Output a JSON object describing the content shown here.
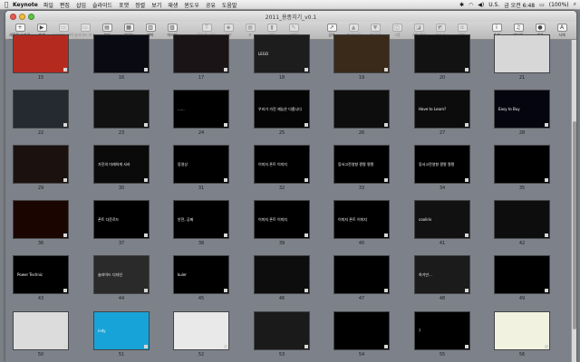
{
  "menubar": {
    "app_name": "Keynote",
    "menus": [
      "파일",
      "편집",
      "삽입",
      "슬라이드",
      "포맷",
      "정렬",
      "보기",
      "재생",
      "윈도우",
      "공유",
      "도움말"
    ],
    "clock": "금 오전 6:48",
    "battery": "(100%)",
    "input_source": "U.S."
  },
  "window": {
    "title": "2011_용종치기_v0.1"
  },
  "toolbar": {
    "left": [
      {
        "label": "새로운 슬라이드",
        "icon": "+",
        "enabled": true
      },
      {
        "label": "재생",
        "icon": "▶",
        "enabled": true
      },
      {
        "label": "슬라이드 레이아웃",
        "icon": "▭",
        "enabled": false
      },
      {
        "label": "슬라이드 마스터",
        "icon": "▭",
        "enabled": false
      },
      {
        "label": "보기",
        "icon": "▤",
        "enabled": true
      },
      {
        "label": "가이드",
        "icon": "▦",
        "enabled": true
      },
      {
        "label": "테마",
        "icon": "▥",
        "enabled": true
      },
      {
        "label": "마스터",
        "icon": "▧",
        "enabled": true
      }
    ],
    "middle": [
      {
        "label": "텍스트 상자",
        "icon": "T",
        "enabled": false
      },
      {
        "label": "도형",
        "icon": "◆",
        "enabled": false
      },
      {
        "label": "표",
        "icon": "▦",
        "enabled": false
      },
      {
        "label": "차트",
        "icon": "▮",
        "enabled": false
      },
      {
        "label": "코멘트",
        "icon": "✎",
        "enabled": false
      }
    ],
    "right_middle": [
      {
        "label": "공유",
        "icon": "↗",
        "enabled": true
      },
      {
        "label": "맨 앞으로",
        "icon": "▲",
        "enabled": false
      },
      {
        "label": "맨 뒤로",
        "icon": "▼",
        "enabled": false
      },
      {
        "label": "그룹",
        "icon": "◫",
        "enabled": false
      },
      {
        "label": "그룹 해제",
        "icon": "◪",
        "enabled": false
      },
      {
        "label": "마스크",
        "icon": "◩",
        "enabled": false
      },
      {
        "label": "알파",
        "icon": "α",
        "enabled": false
      }
    ],
    "right": [
      {
        "label": "속성",
        "icon": "i",
        "enabled": true
      },
      {
        "label": "미디어",
        "icon": "♫",
        "enabled": true
      },
      {
        "label": "색상",
        "icon": "●",
        "enabled": true
      },
      {
        "label": "서체",
        "icon": "A",
        "enabled": true
      }
    ]
  },
  "slides": [
    {
      "n": "15",
      "bg": "#b52a1f",
      "text": ""
    },
    {
      "n": "16",
      "bg": "#0a0a12",
      "text": ""
    },
    {
      "n": "17",
      "bg": "#1a1416",
      "text": ""
    },
    {
      "n": "18",
      "bg": "#1d1d1d",
      "text": "LEGO"
    },
    {
      "n": "19",
      "bg": "#3a2a1a",
      "text": ""
    },
    {
      "n": "20",
      "bg": "#121212",
      "text": ""
    },
    {
      "n": "21",
      "bg": "#d7d7d7",
      "text": ""
    },
    {
      "n": "22",
      "bg": "#242a30",
      "text": ""
    },
    {
      "n": "23",
      "bg": "#111111",
      "text": ""
    },
    {
      "n": "24",
      "bg": "#000000",
      "text": "......"
    },
    {
      "n": "25",
      "bg": "#050505",
      "text": "우리가 가진 재능은 다릅니다"
    },
    {
      "n": "26",
      "bg": "#0d0d0d",
      "text": ""
    },
    {
      "n": "27",
      "bg": "#0c0c0c",
      "text": "Have to Learn?"
    },
    {
      "n": "28",
      "bg": "#050510",
      "text": "Easy to Buy"
    },
    {
      "n": "29",
      "bg": "#1b1210",
      "text": ""
    },
    {
      "n": "30",
      "bg": "#0a0a0a",
      "text": "가진의 미래하게 사라"
    },
    {
      "n": "31",
      "bg": "#000000",
      "text": "동영상"
    },
    {
      "n": "32",
      "bg": "#000000",
      "text": "이미지 폰트 이미지"
    },
    {
      "n": "33",
      "bg": "#000000",
      "text": "동서고전영향 짱짱 짱짱"
    },
    {
      "n": "34",
      "bg": "#000000",
      "text": "동서고전영향 짱짱 짱짱"
    },
    {
      "n": "35",
      "bg": "#000000",
      "text": ""
    },
    {
      "n": "36",
      "bg": "#1a0500",
      "text": ""
    },
    {
      "n": "37",
      "bg": "#000000",
      "text": "폰트 다운로드"
    },
    {
      "n": "38",
      "bg": "#000000",
      "text": "안전, 공짜"
    },
    {
      "n": "39",
      "bg": "#000000",
      "text": "이미지 폰트 이미지"
    },
    {
      "n": "40",
      "bg": "#000000",
      "text": "이미지 폰트 이미지"
    },
    {
      "n": "41",
      "bg": "#111111",
      "text": "cooliris"
    },
    {
      "n": "42",
      "bg": "#0d0d0d",
      "text": ""
    },
    {
      "n": "43",
      "bg": "#000000",
      "text": "Power Technic"
    },
    {
      "n": "44",
      "bg": "#2a2a2a",
      "text": "슬라이드 디자인"
    },
    {
      "n": "45",
      "bg": "#000000",
      "text": "kuler"
    },
    {
      "n": "46",
      "bg": "#0d0d0d",
      "text": ""
    },
    {
      "n": "47",
      "bg": "#000000",
      "text": ""
    },
    {
      "n": "48",
      "bg": "#1b1b1b",
      "text": "하기만..."
    },
    {
      "n": "49",
      "bg": "#000000",
      "text": ""
    },
    {
      "n": "50",
      "bg": "#dcdcdc",
      "text": ""
    },
    {
      "n": "51",
      "bg": "#18a3d8",
      "text": "indy"
    },
    {
      "n": "52",
      "bg": "#e9e9e9",
      "text": ""
    },
    {
      "n": "53",
      "bg": "#1a1a1a",
      "text": ""
    },
    {
      "n": "54",
      "bg": "#000000",
      "text": ""
    },
    {
      "n": "55",
      "bg": "#000000",
      "text": "?"
    },
    {
      "n": "56",
      "bg": "#f2f2e0",
      "text": ""
    }
  ]
}
